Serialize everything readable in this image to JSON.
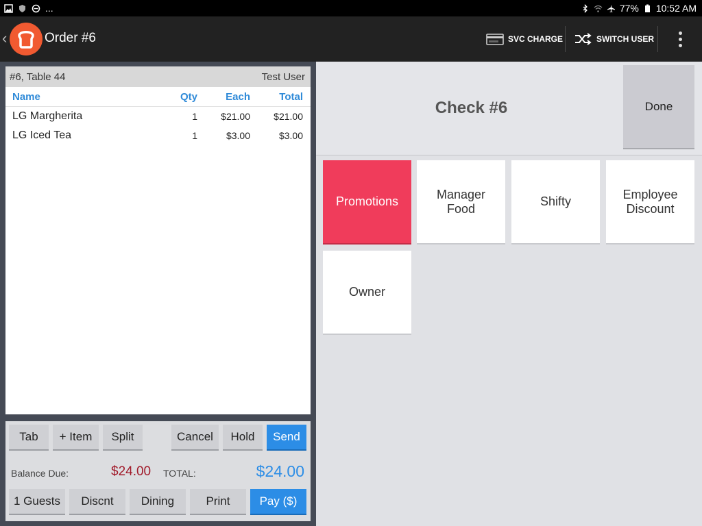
{
  "status_bar": {
    "battery": "77%",
    "time": "10:52 AM",
    "more": "..."
  },
  "action_bar": {
    "title": "Order #6",
    "svc_charge": "SVC CHARGE",
    "switch_user": "SWITCH USER"
  },
  "check": {
    "header_left": "#6, Table 44",
    "header_right": "Test User",
    "columns": {
      "name": "Name",
      "qty": "Qty",
      "each": "Each",
      "total": "Total"
    },
    "items": [
      {
        "name": "LG Margherita",
        "qty": "1",
        "each": "$21.00",
        "total": "$21.00"
      },
      {
        "name": "LG Iced Tea",
        "qty": "1",
        "each": "$3.00",
        "total": "$3.00"
      }
    ]
  },
  "actions_row1": {
    "tab": "Tab",
    "add_item": "+ Item",
    "split": "Split",
    "cancel": "Cancel",
    "hold": "Hold",
    "send": "Send"
  },
  "totals": {
    "balance_label": "Balance Due:",
    "balance_value": "$24.00",
    "total_label": "TOTAL:",
    "total_value": "$24.00"
  },
  "actions_row2": {
    "guests": "1 Guests",
    "discount": "Discnt",
    "dining": "Dining",
    "print": "Print",
    "pay": "Pay ($)"
  },
  "right_panel": {
    "check_title": "Check #6",
    "done": "Done",
    "tiles": [
      "Promotions",
      "Manager\nFood",
      "Shifty",
      "Employee\nDiscount",
      "Owner"
    ]
  },
  "colors": {
    "accent_blue": "#2c8de6",
    "promo_red": "#f03c5b",
    "balance_red": "#a11a2a",
    "logo_orange": "#f15a31"
  }
}
